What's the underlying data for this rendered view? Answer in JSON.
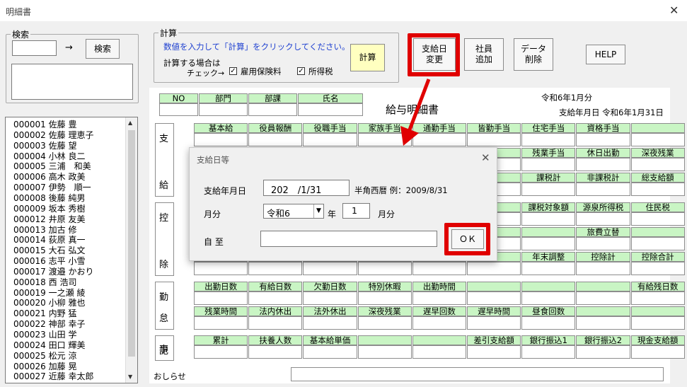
{
  "window": {
    "title": "明細書"
  },
  "search": {
    "legend": "検索",
    "arrow": "→",
    "button": "検索"
  },
  "calc": {
    "legend": "計算",
    "hint": "数値を入力して「計算」をクリックしてください。",
    "label1": "計算する場合は",
    "label2": "チェック→",
    "chk1": "雇用保険料",
    "chk2": "所得税",
    "button": "計算"
  },
  "toolbar": {
    "pay_date_change": [
      "支給日",
      "変更"
    ],
    "add_employee": [
      "社員",
      "追加"
    ],
    "delete_data": [
      "データ",
      "削除"
    ],
    "help": "HELP"
  },
  "employees": [
    "000001 佐藤 豊",
    "000002 佐藤 理恵子",
    "000003 佐藤 望",
    "000004 小林 良二",
    "000005 三浦　和美",
    "000006 高木 政美",
    "000007 伊勢　順一",
    "000008 後藤 純男",
    "000009 坂本 秀樹",
    "000012 井原 友美",
    "000013 加古 修",
    "000014 荻原 真一",
    "000015 大石 弘文",
    "000016 志平 小雪",
    "000017 渡邉 かおり",
    "000018 西 浩司",
    "000019 一之瀬 綾",
    "000020 小柳 雅也",
    "000021 内野 猛",
    "000022 神部 幸子",
    "000023 山田 学",
    "000024 田口 輝美",
    "000025 松元 涼",
    "000026 加藤 晃",
    "000027 近藤 幸太郎"
  ],
  "sheet": {
    "id_headers": [
      "NO",
      "部門",
      "部課",
      "氏名"
    ],
    "title": "給与明細書",
    "month": "令和6年1月分",
    "pay_date": "支給年月日  令和6年1月31日",
    "sections": {
      "pay": [
        "支",
        "給"
      ],
      "deduct": [
        "控",
        "除"
      ],
      "attend": [
        "勤",
        "怠"
      ],
      "record": [
        "記",
        "事"
      ]
    },
    "pay_row1": [
      "基本給",
      "役員報酬",
      "役職手当",
      "家族手当",
      "通勤手当",
      "皆勤手当",
      "住宅手当",
      "資格手当",
      ""
    ],
    "pay_row2_visible": [
      "残業手当",
      "休日出勤",
      "深夜残業"
    ],
    "pay_row3_visible": [
      "課税計",
      "非課税計",
      "総支給額"
    ],
    "ded_row1_visible": [
      "課税対象額",
      "源泉所得税",
      "住民税"
    ],
    "ded_row2_visible": [
      "旅費立替"
    ],
    "ded_row3_visible": [
      "年末調整",
      "控除計",
      "控除合計"
    ],
    "ded_partial": "保",
    "att_row1": [
      "出勤日数",
      "有給日数",
      "欠勤日数",
      "特別休暇",
      "出勤時間",
      "",
      "",
      "",
      "有給残日数"
    ],
    "att_row2": [
      "残業時間",
      "法内休出",
      "法外休出",
      "深夜残業",
      "遅早回数",
      "遅早時間",
      "昼食回数",
      "",
      ""
    ],
    "rec_row": [
      "累計",
      "扶養人数",
      "基本給単価",
      "",
      "",
      "差引支給額",
      "銀行振込1",
      "銀行振込2",
      "現金支給額"
    ],
    "notice_label": "おしらせ"
  },
  "dialog": {
    "title": "支給日等",
    "date_label": "支給年月日",
    "date_value": "202　/1/31",
    "date_hint": "半角西暦  例：2009/8/31",
    "month_label": "月分",
    "era_value": "令和6",
    "year_suffix": "年",
    "month_value": "1",
    "month_suffix": "月分",
    "range_label": "自  至",
    "ok": "ＯＫ"
  }
}
